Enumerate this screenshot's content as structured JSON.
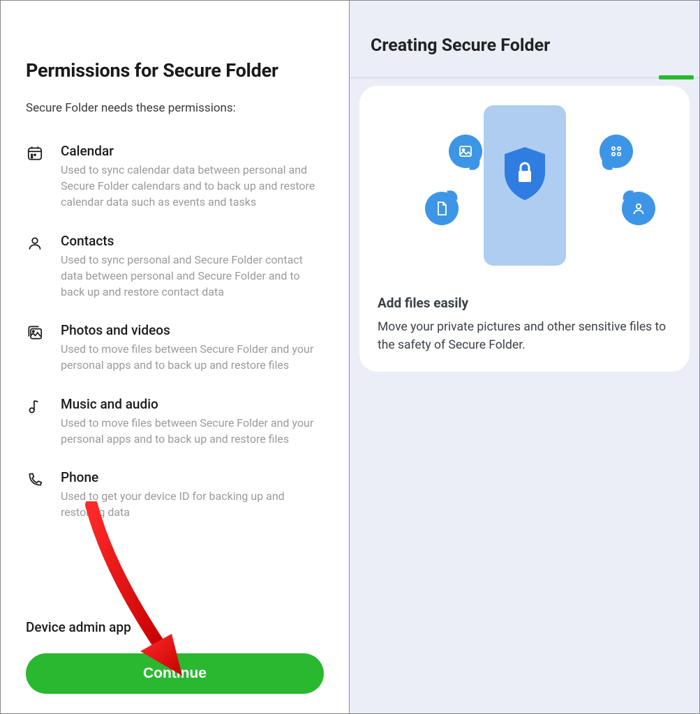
{
  "left": {
    "title": "Permissions for Secure Folder",
    "intro": "Secure Folder needs these permissions:",
    "permissions": [
      {
        "title": "Calendar",
        "desc": "Used to sync calendar data between personal and Secure Folder calendars and to back up and restore calendar data such as events and tasks"
      },
      {
        "title": "Contacts",
        "desc": "Used to sync personal and Secure Folder contact data between personal and Secure Folder and to back up and restore contact data"
      },
      {
        "title": "Photos and videos",
        "desc": "Used to move files between Secure Folder and your personal apps and to back up and restore files"
      },
      {
        "title": "Music and audio",
        "desc": "Used to move files between Secure Folder and your personal apps and to back up and restore files"
      },
      {
        "title": "Phone",
        "desc": "Used to get your device ID for backing up and restoring data"
      }
    ],
    "section_label": "Device admin app",
    "button": "Continue"
  },
  "right": {
    "title": "Creating Secure Folder",
    "card_title": "Add files easily",
    "card_desc": "Move your private pictures and other sensitive files to the safety of Secure Folder."
  }
}
